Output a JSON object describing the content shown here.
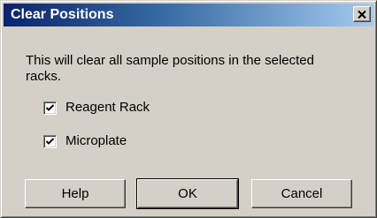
{
  "dialog": {
    "title": "Clear Positions",
    "close_icon": "close-icon",
    "message": "This will clear all sample positions in the selected racks.",
    "options": [
      {
        "label": "Reagent Rack",
        "checked": true
      },
      {
        "label": "Microplate",
        "checked": true
      }
    ],
    "buttons": {
      "help": "Help",
      "ok": "OK",
      "cancel": "Cancel"
    },
    "default_button": "ok"
  },
  "colors": {
    "face": "#d4d0c8",
    "title_start": "#0a246a",
    "title_end": "#a6caf0",
    "title_text": "#ffffff"
  }
}
